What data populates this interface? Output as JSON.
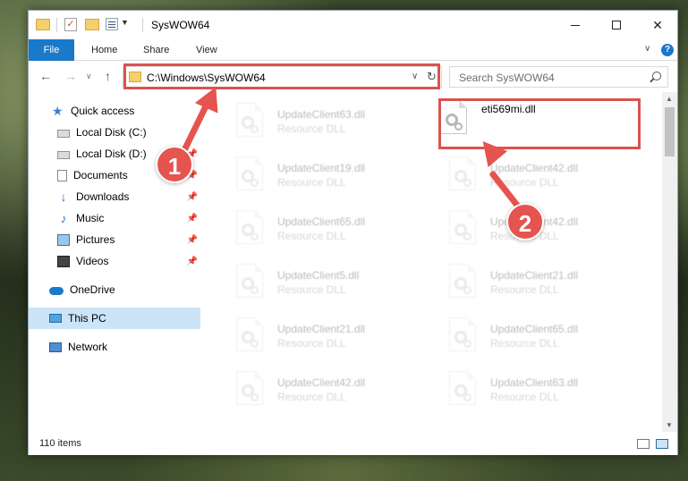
{
  "window": {
    "title": "SysWOW64"
  },
  "ribbon": {
    "file": "File",
    "home": "Home",
    "share": "Share",
    "view": "View"
  },
  "address": {
    "path": "C:\\Windows\\SysWOW64",
    "search_placeholder": "Search SysWOW64"
  },
  "sidebar": {
    "items": [
      {
        "label": "Quick access",
        "icon": "star-icon",
        "pinned": false
      },
      {
        "label": "Local Disk (C:)",
        "icon": "drive-icon",
        "pinned": false
      },
      {
        "label": "Local Disk (D:)",
        "icon": "drive-icon",
        "pinned": true
      },
      {
        "label": "Documents",
        "icon": "documents-icon",
        "pinned": true
      },
      {
        "label": "Downloads",
        "icon": "download-icon",
        "pinned": true
      },
      {
        "label": "Music",
        "icon": "music-icon",
        "pinned": true
      },
      {
        "label": "Pictures",
        "icon": "pictures-icon",
        "pinned": true
      },
      {
        "label": "Videos",
        "icon": "videos-icon",
        "pinned": true
      },
      {
        "label": "OneDrive",
        "icon": "onedrive-icon",
        "pinned": false
      },
      {
        "label": "This PC",
        "icon": "this-pc-icon",
        "pinned": false,
        "selected": true
      },
      {
        "label": "Network",
        "icon": "network-icon",
        "pinned": false
      }
    ]
  },
  "files": [
    {
      "name": "UpdateClient63.dll",
      "type": "Resource DLL"
    },
    {
      "name": "eti569mi.dll",
      "type": ""
    },
    {
      "name": "UpdateClient19.dll",
      "type": "Resource DLL"
    },
    {
      "name": "UpdateClient42.dll",
      "type": "Resource DLL"
    },
    {
      "name": "UpdateClient65.dll",
      "type": "Resource DLL"
    },
    {
      "name": "UpdateClient42.dll",
      "type": "Resource DLL"
    },
    {
      "name": "UpdateClient5.dll",
      "type": "Resource DLL"
    },
    {
      "name": "UpdateClient21.dll",
      "type": "Resource DLL"
    },
    {
      "name": "UpdateClient21.dll",
      "type": "Resource DLL"
    },
    {
      "name": "UpdateClient65.dll",
      "type": "Resource DLL"
    },
    {
      "name": "UpdateClient42.dll",
      "type": "Resource DLL"
    },
    {
      "name": "UpdateClient63.dll",
      "type": "Resource DLL"
    }
  ],
  "status": {
    "item_count": "110 items"
  },
  "callouts": {
    "step1": "1",
    "step2": "2"
  },
  "colors": {
    "accent": "#1979ca",
    "highlight": "#d9534f",
    "arrow": "#e5544e",
    "selected": "#cce4f7"
  }
}
